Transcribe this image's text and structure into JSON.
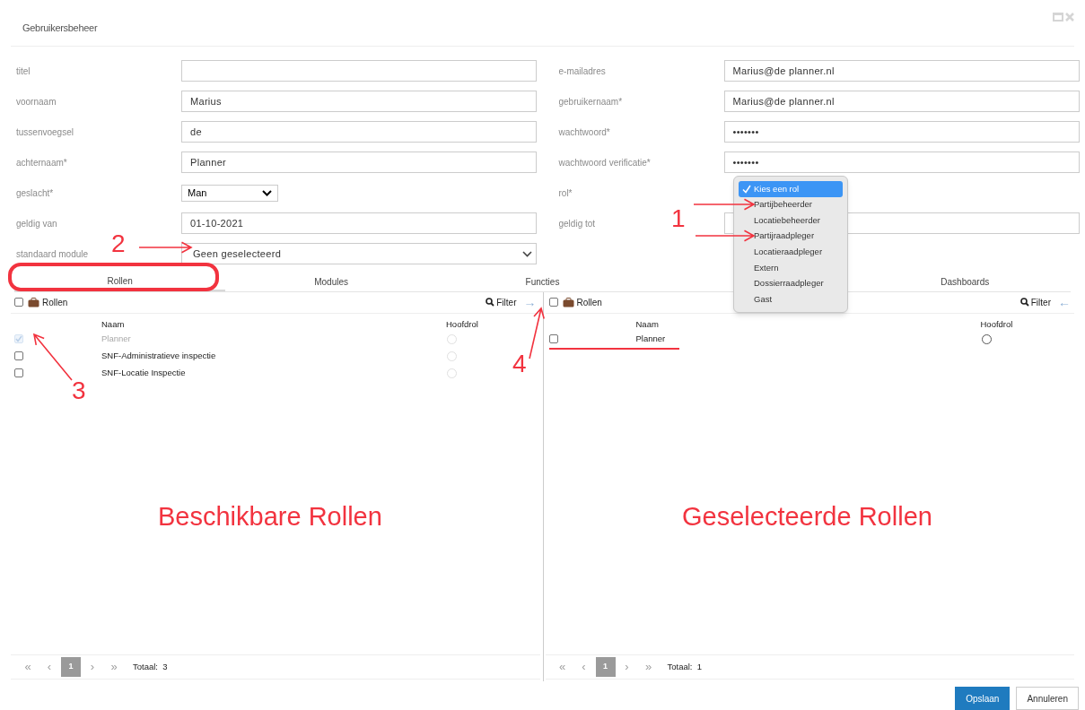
{
  "window": {
    "title": "Gebruikersbeheer"
  },
  "form_left": [
    {
      "label": "titel",
      "kind": "text"
    },
    {
      "label": "voornaam",
      "kind": "text",
      "value": "Marius"
    },
    {
      "label": "tussenvoegsel",
      "kind": "text",
      "value": "de"
    },
    {
      "label": "achternaam*",
      "kind": "text",
      "value": "Planner"
    },
    {
      "label": "geslacht*",
      "kind": "small_select",
      "value": "Man"
    },
    {
      "label": "geldig van",
      "kind": "text",
      "value": "01-10-2021"
    },
    {
      "label": "standaard module",
      "kind": "select",
      "value": "Geen geselecteerd"
    }
  ],
  "form_right": [
    {
      "label": "e-mailadres",
      "kind": "text",
      "value": "Marius@de planner.nl"
    },
    {
      "label": "gebruikernaam*",
      "kind": "text",
      "value": "Marius@de planner.nl"
    },
    {
      "label": "wachtwoord*",
      "kind": "text",
      "value": "•••••••"
    },
    {
      "label": "wachtwoord verificatie*",
      "kind": "text",
      "value": "•••••••"
    },
    {
      "label": "rol*",
      "kind": "popup"
    },
    {
      "label": "geldig tot",
      "kind": "text"
    }
  ],
  "role_menu": [
    {
      "label": "Kies een rol",
      "selected": true
    },
    {
      "label": "Partijbeheerder",
      "selected": false
    },
    {
      "label": "Locatiebeheerder",
      "selected": false
    },
    {
      "label": "Partijraadpleger",
      "selected": false
    },
    {
      "label": "Locatieraadpleger",
      "selected": false
    },
    {
      "label": "Extern",
      "selected": false
    },
    {
      "label": "Dossierraadpleger",
      "selected": false
    },
    {
      "label": "Gast",
      "selected": false
    }
  ],
  "tabs": [
    {
      "label": "Rollen",
      "selected": true
    },
    {
      "label": "Modules",
      "selected": false
    },
    {
      "label": "Functies",
      "selected": false
    },
    {
      "label": "Dashboards",
      "selected": false
    }
  ],
  "panels": [
    {
      "all_checked": false,
      "title": "Rollen",
      "filter": "Filter",
      "move": "→",
      "columns": [
        "Naam",
        "Hoofdrol"
      ],
      "rows": [
        {
          "name": "Planner",
          "checked": true,
          "disabled": true,
          "main": false
        },
        {
          "name": "SNF-Administratieve inspectie",
          "checked": false,
          "disabled": false,
          "main": false
        },
        {
          "name": "SNF-Locatie Inspectie",
          "checked": false,
          "disabled": false,
          "main": false
        }
      ],
      "pager": [
        {
          "label": "«",
          "kind": "nav"
        },
        {
          "label": "‹",
          "kind": "nav"
        },
        {
          "label": "1",
          "kind": "page"
        },
        {
          "label": "›",
          "kind": "nav"
        },
        {
          "label": "»",
          "kind": "nav"
        }
      ],
      "total": "Totaal:  3"
    },
    {
      "all_checked": false,
      "title": "Rollen",
      "filter": "Filter",
      "move": "←",
      "columns": [
        "Naam",
        "Hoofdrol"
      ],
      "rows": [
        {
          "name": "Planner",
          "checked": false,
          "disabled": false,
          "main": false
        }
      ],
      "pager": [
        {
          "label": "«",
          "kind": "nav"
        },
        {
          "label": "‹",
          "kind": "nav"
        },
        {
          "label": "1",
          "kind": "page"
        },
        {
          "label": "›",
          "kind": "nav"
        },
        {
          "label": "»",
          "kind": "nav"
        }
      ],
      "total": "Totaal:  1"
    }
  ],
  "buttons": [
    {
      "label": "Opslaan",
      "kind": "primary"
    },
    {
      "label": "Annuleren",
      "kind": "secondary"
    }
  ],
  "annotations": [
    {
      "text": "2",
      "kind": "number"
    },
    {
      "text": "1",
      "kind": "number"
    },
    {
      "text": "3",
      "kind": "number"
    },
    {
      "text": "4",
      "kind": "number"
    },
    {
      "text": "Beschikbare Rollen",
      "kind": "caption"
    },
    {
      "text": "Geselecteerde Rollen",
      "kind": "caption"
    }
  ]
}
